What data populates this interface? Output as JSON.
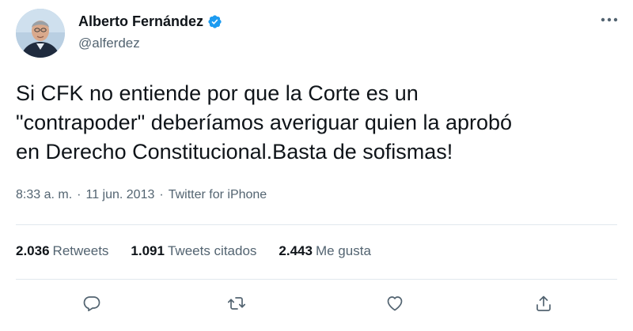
{
  "author": {
    "display_name": "Alberto Fernández",
    "handle": "@alferdez",
    "verified": true
  },
  "tweet": {
    "text": "Si CFK no entiende por que la Corte es un\n\"contrapoder\" deberíamos averiguar quien la aprobó\nen Derecho Constitucional.Basta de sofismas!"
  },
  "meta": {
    "time": "8:33 a. m.",
    "separator": "·",
    "date": "11 jun. 2013",
    "source": "Twitter for iPhone"
  },
  "stats": {
    "retweets": {
      "count": "2.036",
      "label": "Retweets"
    },
    "quotes": {
      "count": "1.091",
      "label": "Tweets citados"
    },
    "likes": {
      "count": "2.443",
      "label": "Me gusta"
    }
  },
  "icons": {
    "verified": "verified-badge-icon",
    "more": "more-options-icon",
    "reply": "reply-icon",
    "retweet": "retweet-icon",
    "like": "heart-icon",
    "share": "share-icon"
  },
  "colors": {
    "text": "#0f1419",
    "secondary": "#536471",
    "verified": "#1d9bf0",
    "divider": "#e1e8ed"
  }
}
